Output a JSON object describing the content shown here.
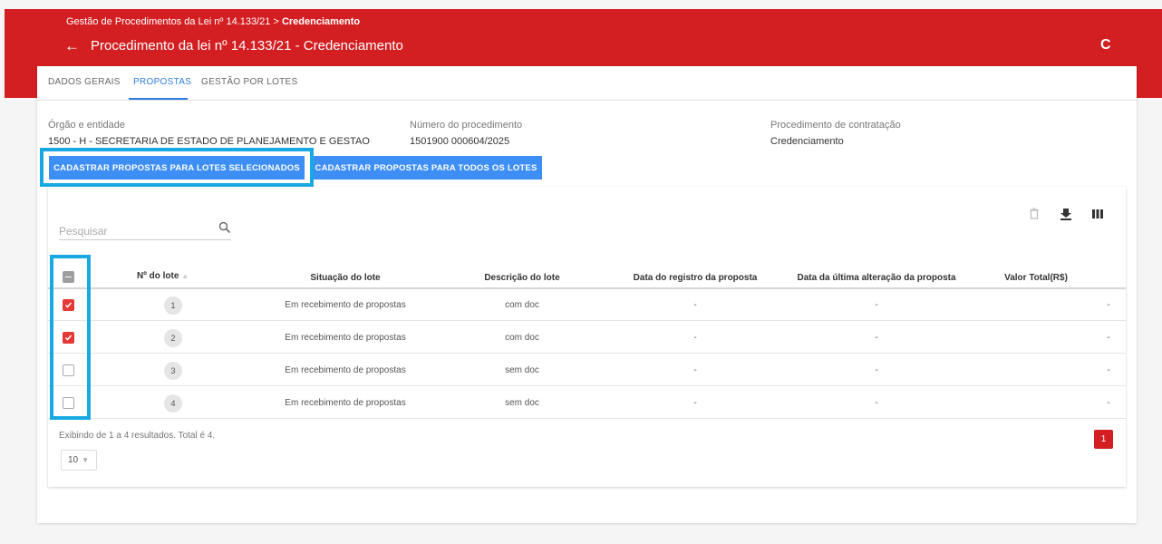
{
  "header": {
    "breadcrumb_prefix": "Gestão de Procedimentos da Lei nº 14.133/21 > ",
    "breadcrumb_current": "Credenciamento",
    "back_icon": "←",
    "title": "Procedimento da lei nº 14.133/21 - Credenciamento",
    "refresh_icon": "C"
  },
  "tabs": [
    {
      "label": "DADOS GERAIS"
    },
    {
      "label": "PROPOSTAS",
      "active": true
    },
    {
      "label": "GESTÃO POR LOTES"
    }
  ],
  "info": {
    "orgao_label": "Órgão e entidade",
    "orgao_value": "1500 - H - SECRETARIA DE ESTADO DE PLANEJAMENTO E GESTAO",
    "numero_label": "Número do procedimento",
    "numero_value": "1501900 000604/2025",
    "procedimento_label": "Procedimento de contratação",
    "procedimento_value": "Credenciamento"
  },
  "buttons": {
    "selected_lots": "CADASTRAR PROPOSTAS PARA LOTES SELECIONADOS",
    "all_lots": "CADASTRAR PROPOSTAS PARA TODOS OS LOTES"
  },
  "search": {
    "placeholder": "Pesquisar"
  },
  "table": {
    "columns": [
      "Nº do lote",
      "Situação do lote",
      "Descrição do lote",
      "Data do registro da proposta",
      "Data da última alteração da proposta",
      "Valor Total(R$)"
    ],
    "sort_indicator": "▲",
    "rows": [
      {
        "checked": true,
        "lote": "1",
        "situacao": "Em recebimento de propostas",
        "descricao": "com doc",
        "data_registro": "-",
        "data_alteracao": "-",
        "valor": "-"
      },
      {
        "checked": true,
        "lote": "2",
        "situacao": "Em recebimento de propostas",
        "descricao": "com doc",
        "data_registro": "-",
        "data_alteracao": "-",
        "valor": "-"
      },
      {
        "checked": false,
        "lote": "3",
        "situacao": "Em recebimento de propostas",
        "descricao": "sem doc",
        "data_registro": "-",
        "data_alteracao": "-",
        "valor": "-"
      },
      {
        "checked": false,
        "lote": "4",
        "situacao": "Em recebimento de propostas",
        "descricao": "sem doc",
        "data_registro": "-",
        "data_alteracao": "-",
        "valor": "-"
      }
    ]
  },
  "footer": {
    "summary": "Exibindo de 1 a 4 resultados. Total é 4.",
    "page_size": "10",
    "page_size_caret": "▼",
    "current_page": "1"
  },
  "colors": {
    "brand_red": "#d41f22",
    "primary_blue": "#3d8ef5",
    "highlight": "#19a9e2",
    "check_red": "#e53935"
  },
  "icons": {
    "delete": "trash-icon",
    "download": "download-icon",
    "columns": "columns-icon",
    "search": "search-icon"
  }
}
